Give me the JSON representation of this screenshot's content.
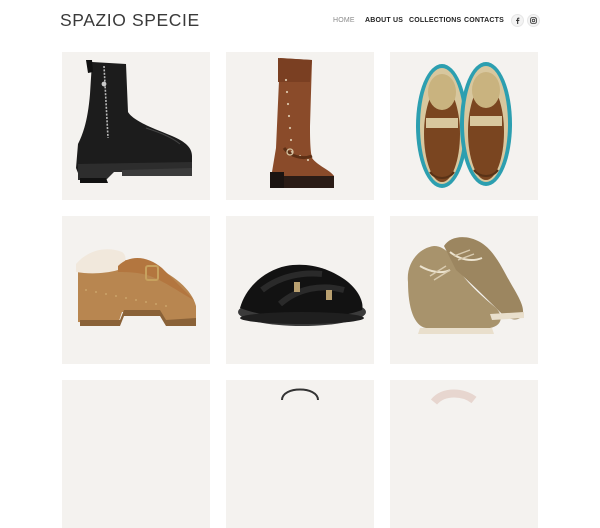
{
  "site": {
    "logo_text": "SPAZIO SPECIE"
  },
  "nav": {
    "items": [
      {
        "label": "HOME",
        "active": true
      },
      {
        "label": "ABOUT US",
        "active": false
      },
      {
        "label": "COLLECTIONS",
        "active": false
      },
      {
        "label": "CONTACTS",
        "active": false
      }
    ]
  },
  "social": [
    {
      "icon": "facebook-icon"
    },
    {
      "icon": "instagram-icon"
    }
  ],
  "products": [
    {
      "icon": "black-zip-ankle-boot-icon"
    },
    {
      "icon": "brown-studded-tall-boot-icon"
    },
    {
      "icon": "two-tone-penny-loafers-icon"
    },
    {
      "icon": "shearling-clog-icon"
    },
    {
      "icon": "black-shearling-slide-icon"
    },
    {
      "icon": "beige-lace-up-shoes-icon"
    },
    {
      "icon": "product-image-icon"
    },
    {
      "icon": "handbag-icon"
    },
    {
      "icon": "product-image-icon"
    }
  ],
  "colors": {
    "tile_background": "#f4f2ef",
    "nav_text": "#222222",
    "nav_active": "#8a8a8a",
    "logo": "#3a3a3a"
  }
}
